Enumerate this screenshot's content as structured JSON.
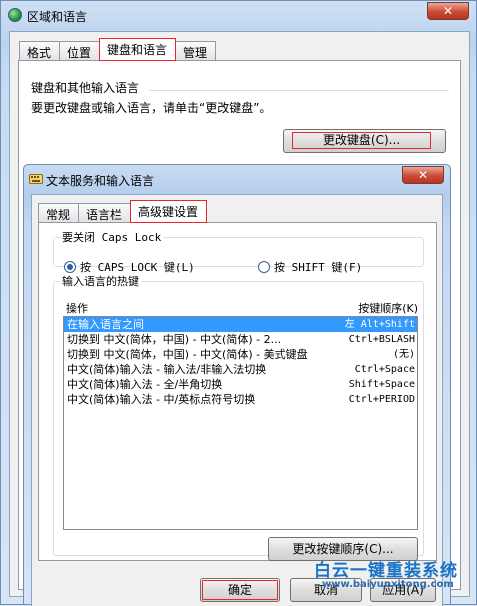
{
  "outer": {
    "title": "区域和语言",
    "close_label": "✕",
    "tabs": [
      {
        "label": "格式",
        "active": false
      },
      {
        "label": "位置",
        "active": false
      },
      {
        "label": "键盘和语言",
        "active": true
      },
      {
        "label": "管理",
        "active": false
      }
    ],
    "group_label": "键盘和其他输入语言",
    "group_desc": "要更改键盘或输入语言，请单击“更改键盘”。",
    "change_keyboard_label": "更改键盘(C)..."
  },
  "inner": {
    "title": "文本服务和输入语言",
    "close_label": "✕",
    "tabs": [
      {
        "label": "常规",
        "active": false
      },
      {
        "label": "语言栏",
        "active": false
      },
      {
        "label": "高级键设置",
        "active": true
      }
    ],
    "caps_group_label": "要关闭 Caps Lock",
    "radio_caps": "按 CAPS LOCK 键(L)",
    "radio_shift": "按 SHIFT 键(F)",
    "hotkey_group_label": "输入语言的热键",
    "col_action": "操作",
    "col_key": "按键顺序(K)",
    "rows": [
      {
        "action": "在输入语言之间",
        "key": "左 Alt+Shift",
        "selected": true
      },
      {
        "action": "切换到 中文(简体，中国) - 中文(简体) - 2...",
        "key": "Ctrl+BSLASH",
        "selected": false
      },
      {
        "action": "切换到 中文(简体，中国) - 中文(简体) - 美式键盘",
        "key": "(无)",
        "selected": false
      },
      {
        "action": "中文(简体)输入法 - 输入法/非输入法切换",
        "key": "Ctrl+Space",
        "selected": false
      },
      {
        "action": "中文(简体)输入法 - 全/半角切换",
        "key": "Shift+Space",
        "selected": false
      },
      {
        "action": "中文(简体)输入法 - 中/英标点符号切换",
        "key": "Ctrl+PERIOD",
        "selected": false
      }
    ],
    "change_sequence_label": "更改按键顺序(C)...",
    "ok_label": "确定",
    "cancel_label": "取消",
    "apply_label": "应用(A)"
  },
  "watermark": {
    "text": "白云一键重装系统",
    "url": "www.baiyunxitong.com"
  },
  "colors": {
    "highlight": "#3399ff",
    "annotation_red": "#e8262a",
    "close_red": "#cc4b36"
  }
}
